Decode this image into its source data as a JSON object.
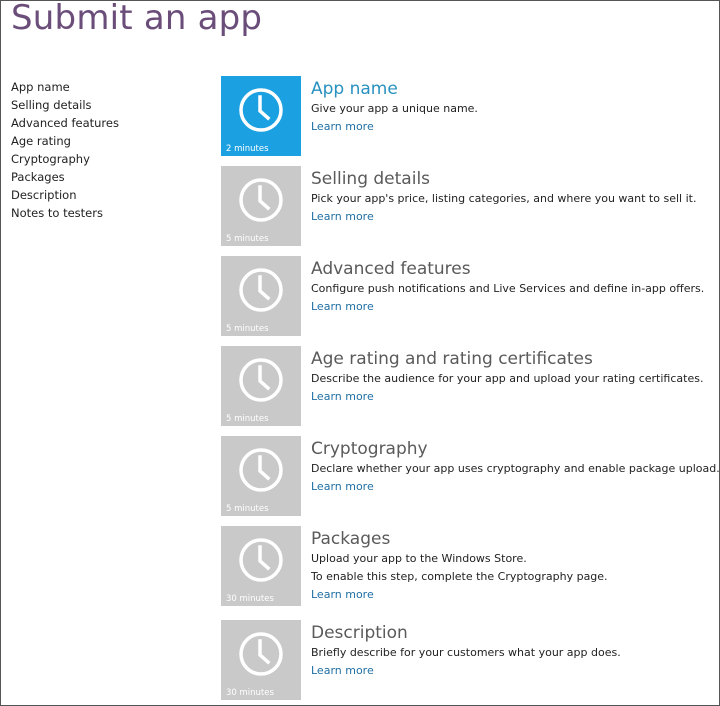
{
  "page_title": "Submit an app",
  "sidebar": {
    "items": [
      {
        "label": "App name"
      },
      {
        "label": "Selling details"
      },
      {
        "label": "Advanced features"
      },
      {
        "label": "Age rating"
      },
      {
        "label": "Cryptography"
      },
      {
        "label": "Packages"
      },
      {
        "label": "Description"
      },
      {
        "label": "Notes to testers"
      }
    ]
  },
  "steps": [
    {
      "title": "App name",
      "description": "Give your app a unique name.",
      "description_2": "",
      "link": "Learn more",
      "duration": "2 minutes",
      "active": true,
      "icon": "clock-icon"
    },
    {
      "title": "Selling details",
      "description": "Pick your app's price, listing categories, and where you want to sell it.",
      "description_2": "",
      "link": "Learn more",
      "duration": "5 minutes",
      "active": false,
      "icon": "clock-icon"
    },
    {
      "title": "Advanced features",
      "description": "Configure push notifications and Live Services and define in-app offers.",
      "description_2": "",
      "link": "Learn more",
      "duration": "5 minutes",
      "active": false,
      "icon": "clock-icon"
    },
    {
      "title": "Age rating and rating certificates",
      "description": "Describe the audience for your app and upload your rating certificates.",
      "description_2": "",
      "link": "Learn more",
      "duration": "5 minutes",
      "active": false,
      "icon": "clock-icon"
    },
    {
      "title": "Cryptography",
      "description": "Declare whether your app uses cryptography and enable package upload.",
      "description_2": "",
      "link": "Learn more",
      "duration": "5 minutes",
      "active": false,
      "icon": "clock-icon"
    },
    {
      "title": "Packages",
      "description": "Upload your app to the Windows Store.",
      "description_2": "To enable this step, complete the Cryptography page.",
      "link": "Learn more",
      "duration": "30 minutes",
      "active": false,
      "icon": "clock-icon"
    },
    {
      "title": "Description",
      "description": "Briefly describe for your customers what your app does.",
      "description_2": "",
      "link": "Learn more",
      "duration": "30 minutes",
      "active": false,
      "icon": "clock-icon"
    }
  ],
  "colors": {
    "title": "#6b4d7a",
    "tile_active": "#1ba1e2",
    "tile_inactive": "#c9c9c9",
    "active_heading": "#2791bf",
    "link": "#1f6fa3"
  }
}
